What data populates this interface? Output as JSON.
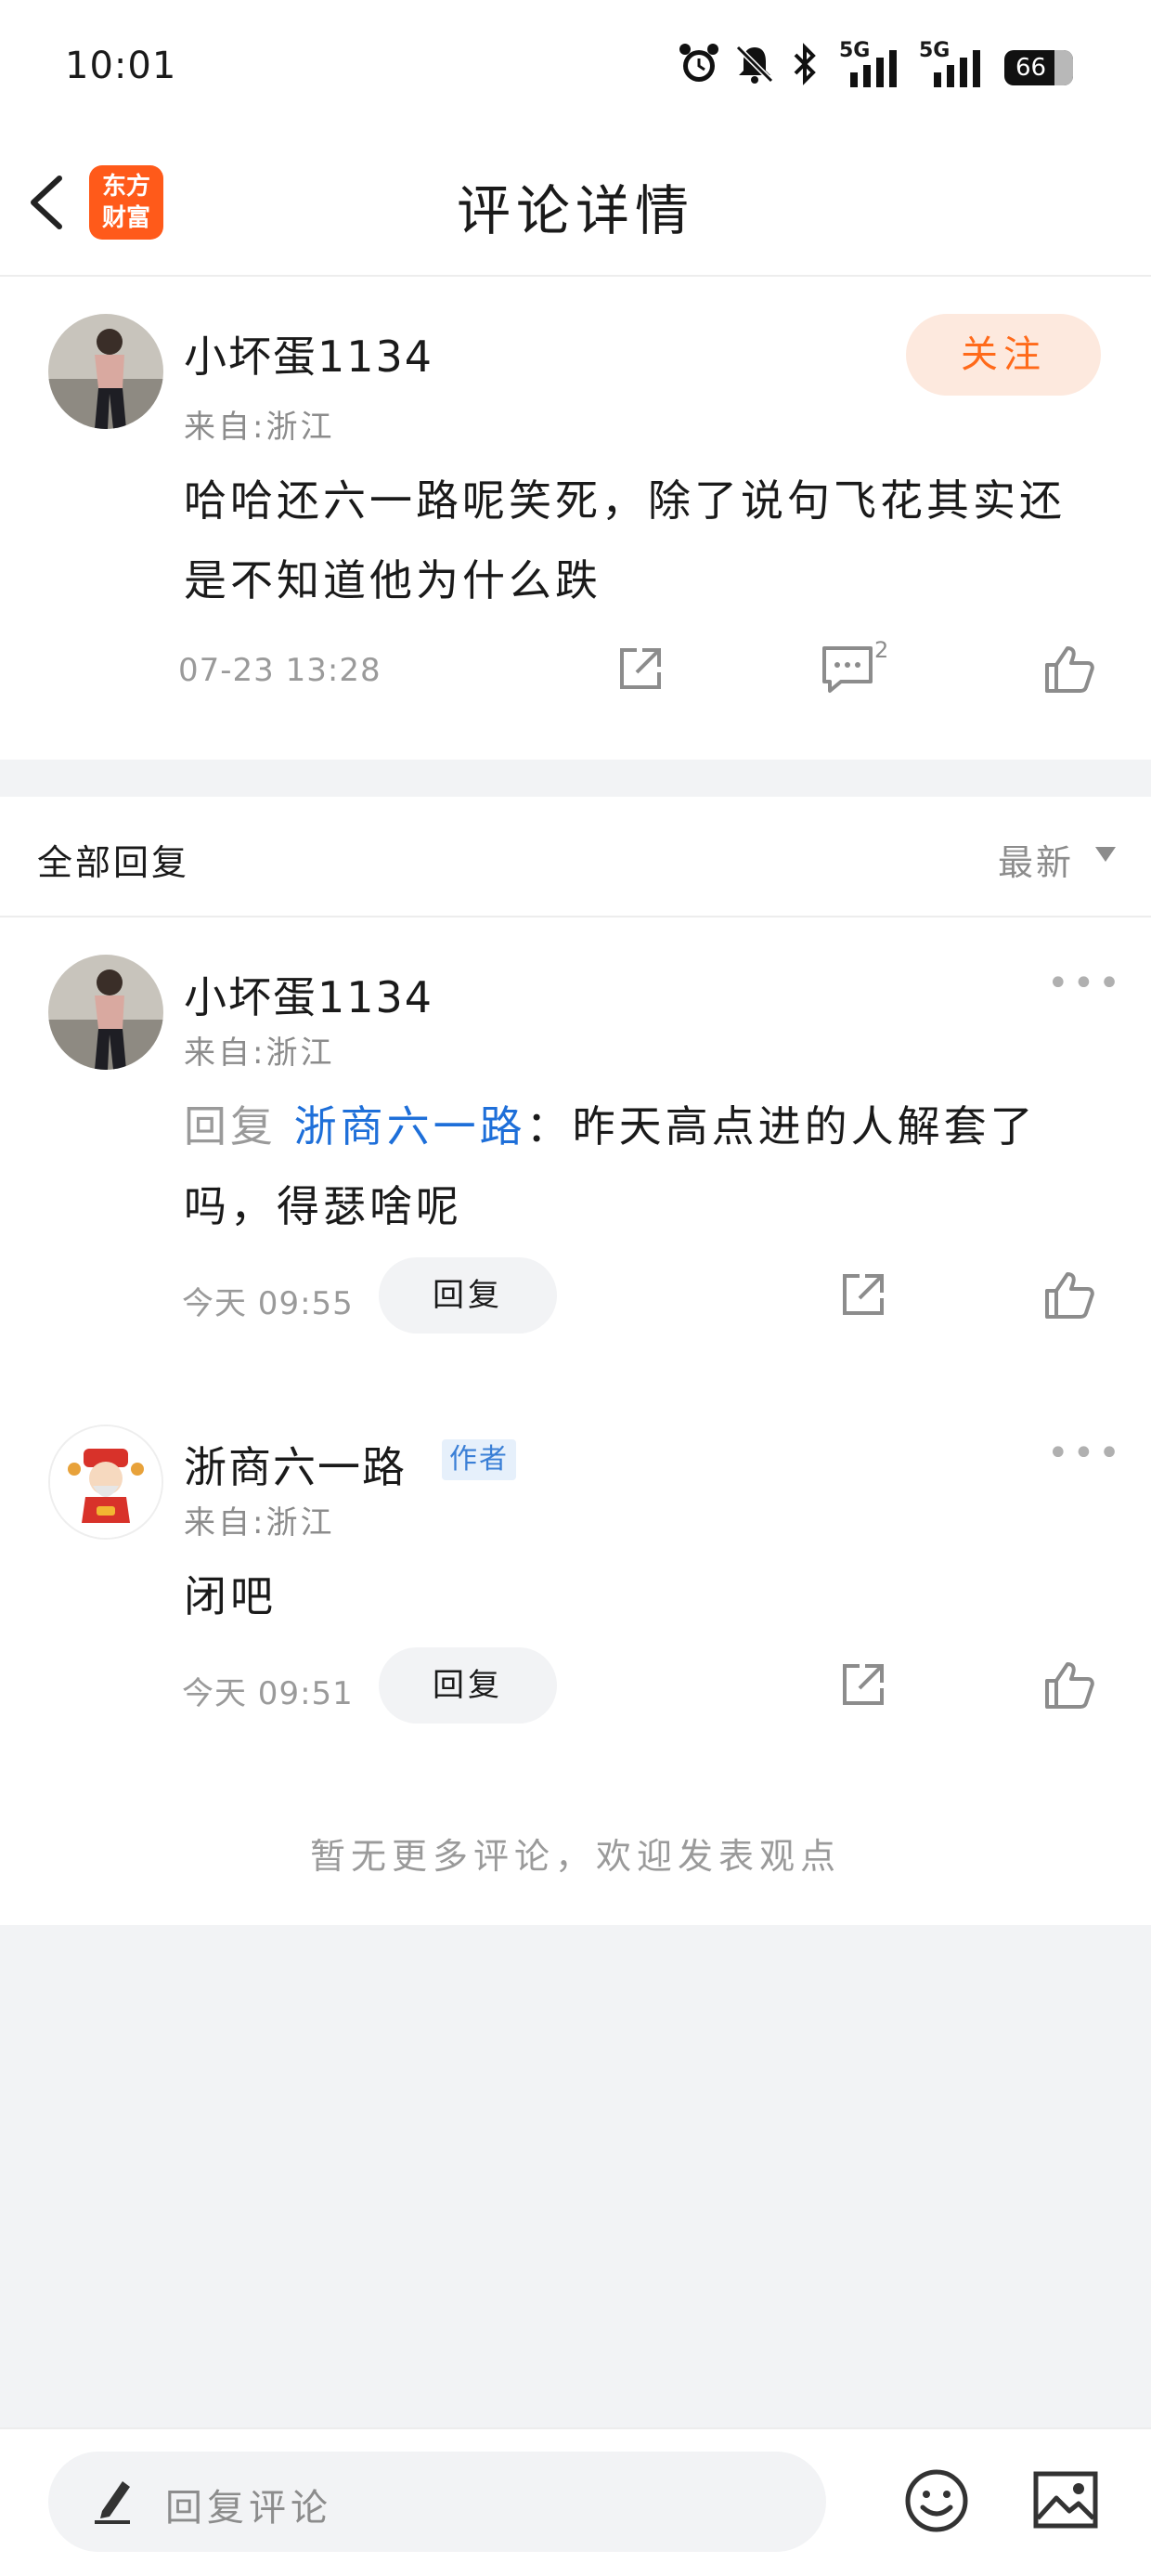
{
  "status_bar": {
    "time": "10:01",
    "signal_1": "5G",
    "signal_2": "5G",
    "battery": "66"
  },
  "nav": {
    "title": "评论详情",
    "logo_line1": "东方",
    "logo_line2": "财富"
  },
  "main_comment": {
    "username": "小坏蛋1134",
    "source": "来自:浙江",
    "follow_label": "关注",
    "text_line1": "哈哈还六一路呢笑死，除了说句飞花其实还",
    "text_line2": "是不知道他为什么跌",
    "timestamp": "07-23 13:28",
    "comment_count": "2"
  },
  "replies_header": {
    "title": "全部回复",
    "sort": "最新"
  },
  "replies": [
    {
      "username": "小坏蛋1134",
      "source": "来自:浙江",
      "prefix": "回复",
      "mention": "浙商六一路",
      "text_line1": "：昨天高点进的人解套了",
      "text_line2": "吗，得瑟啥呢",
      "timestamp": "今天 09:55",
      "reply_label": "回复"
    },
    {
      "username": "浙商六一路",
      "badge": "作者",
      "source": "来自:浙江",
      "text_line1": "闭吧",
      "timestamp": "今天 09:51",
      "reply_label": "回复"
    }
  ],
  "footer_note": "暂无更多评论，欢迎发表观点",
  "bottom_bar": {
    "placeholder": "回复评论"
  },
  "colors": {
    "accent_orange": "#ff6a1a",
    "mention_blue": "#1e6fd9",
    "background": "#f2f3f5"
  }
}
